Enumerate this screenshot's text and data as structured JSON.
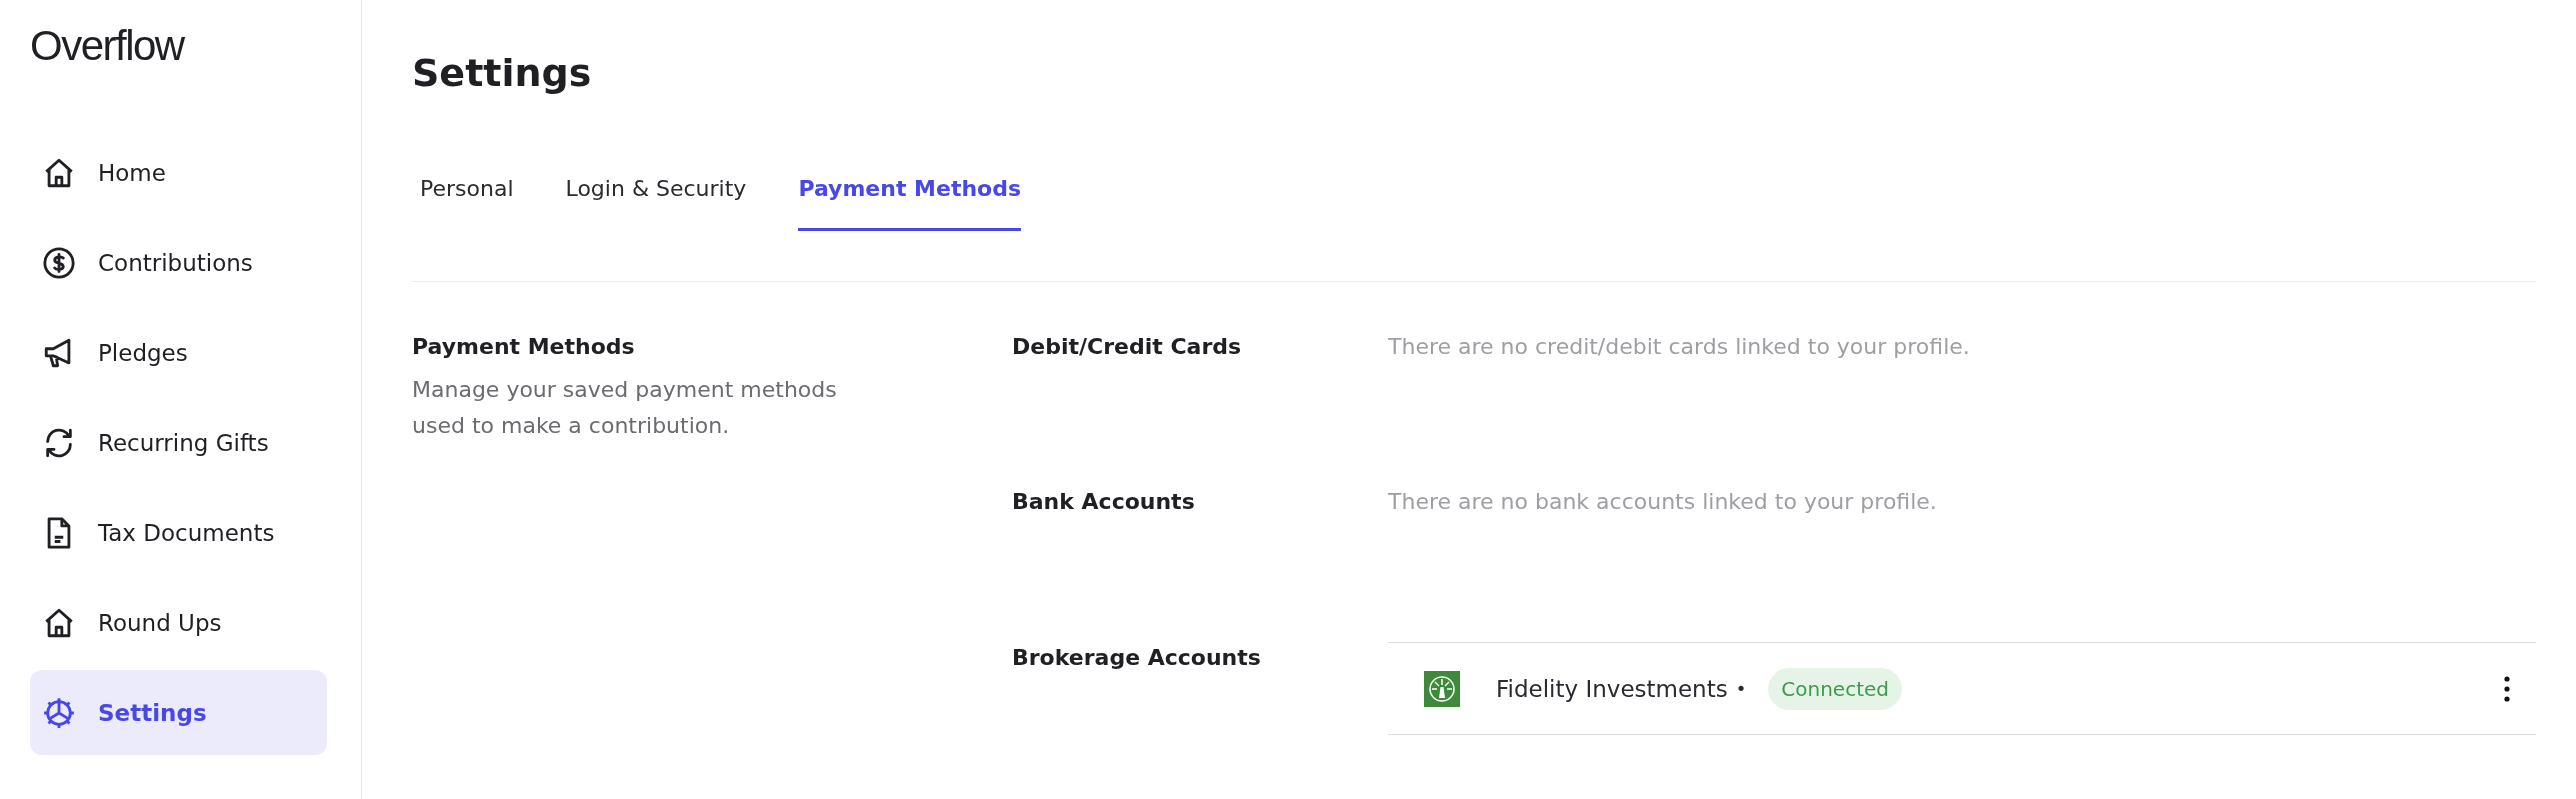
{
  "brand": "Overflow",
  "sidebar": {
    "items": [
      {
        "label": "Home",
        "selected": false
      },
      {
        "label": "Contributions",
        "selected": false
      },
      {
        "label": "Pledges",
        "selected": false
      },
      {
        "label": "Recurring Gifts",
        "selected": false
      },
      {
        "label": "Tax Documents",
        "selected": false
      },
      {
        "label": "Round Ups",
        "selected": false
      },
      {
        "label": "Settings",
        "selected": true
      }
    ]
  },
  "page_title": "Settings",
  "tabs": [
    {
      "label": "Personal",
      "selected": false
    },
    {
      "label": "Login & Security",
      "selected": false
    },
    {
      "label": "Payment Methods",
      "selected": true
    }
  ],
  "section": {
    "title": "Payment Methods",
    "description": "Manage your saved payment methods used to make a contribution."
  },
  "payment_groups": [
    {
      "title": "Debit/Credit Cards",
      "empty_message": "There are no credit/debit cards linked to your profile."
    },
    {
      "title": "Bank Accounts",
      "empty_message": "There are no bank accounts linked to your profile."
    },
    {
      "title": "Brokerage Accounts",
      "accounts": [
        {
          "name": "Fidelity Investments",
          "separator": "•",
          "status": "Connected"
        }
      ]
    }
  ]
}
